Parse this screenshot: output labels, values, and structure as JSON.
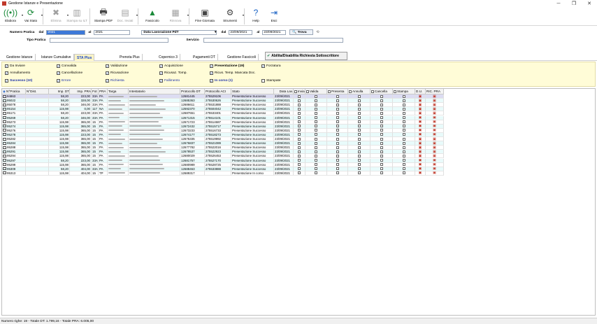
{
  "window": {
    "title": "Gestione Istanze e Presentazione",
    "minimize": "─",
    "maximize": "❐",
    "close": "✕"
  },
  "toolbar": [
    {
      "key": "elabora",
      "label": "Elabora",
      "icon": "((•))",
      "dis": false,
      "dd": true
    },
    {
      "key": "vai-stato",
      "label": "Vai Stato",
      "icon": "⟳",
      "dis": false,
      "dd": true
    },
    {
      "key": "elimina",
      "label": "Elimina",
      "icon": "✖",
      "dis": true,
      "dd": true
    },
    {
      "key": "stampa-ilt",
      "label": "Stampa su ILT",
      "icon": "▥",
      "dis": true,
      "dd": false
    },
    {
      "key": "stampa-pdf",
      "label": "Stampa PDF",
      "icon": "🖶",
      "dis": false,
      "dd": false
    },
    {
      "key": "doc-inviati",
      "label": "Doc. Inviati",
      "icon": "▤",
      "dis": true,
      "dd": true
    },
    {
      "key": "fascicolo",
      "label": "Fascicolo",
      "icon": "▲",
      "dis": false,
      "dd": false
    },
    {
      "key": "rinnova",
      "label": "Rinnova",
      "icon": "▦",
      "dis": true,
      "dd": true
    },
    {
      "key": "fine-giornata",
      "label": "Fine Giornata",
      "icon": "▣",
      "dis": false,
      "dd": false
    },
    {
      "key": "strumenti",
      "label": "Strumenti",
      "icon": "⚙",
      "dis": false,
      "dd": true
    },
    {
      "key": "help",
      "label": "Help",
      "icon": "?",
      "dis": false,
      "dd": false
    },
    {
      "key": "esci",
      "label": "Esci",
      "icon": "⇥",
      "dis": false,
      "dd": false
    }
  ],
  "filters": {
    "numero_pratica_label": "Numero Pratica",
    "dal_label": "dal",
    "al_label": "al",
    "num_dal": "2021",
    "num_al": "2021",
    "data_combo": "Data Lavorazione PdT",
    "data_dal_label": "dal",
    "data_dal": "23/09/2021",
    "data_al_label": "al",
    "data_al": "23/09/2021",
    "trova": "Trova",
    "tipo_pratica_label": "Tipo Pratica",
    "servizio_label": "Servizio"
  },
  "tabs": [
    "Gestione Istanze",
    "Istanze Cumulative",
    "STA Plus",
    "Prenota Plus",
    "Copernico 3",
    "Pagamenti DT",
    "Gestione Fascicoli"
  ],
  "abilita_label": "Abilita/Disabilita Richiesta Sottoscrittore",
  "status_checks": [
    {
      "label": "Da Inviare",
      "on": true,
      "bold": false,
      "blue": false
    },
    {
      "label": "Convalida",
      "on": true,
      "bold": false,
      "blue": false
    },
    {
      "label": "Validazione",
      "on": true,
      "bold": false,
      "blue": false
    },
    {
      "label": "Acquisizione",
      "on": true,
      "bold": false,
      "blue": false
    },
    {
      "label": "Presentazione (19)",
      "on": true,
      "bold": true,
      "blue": false
    },
    {
      "label": "Forzatura",
      "on": true,
      "bold": false,
      "blue": false
    },
    {
      "label": "Annullamento",
      "on": true,
      "bold": false,
      "blue": false
    },
    {
      "label": "Cancellazione",
      "on": true,
      "bold": false,
      "blue": false
    },
    {
      "label": "Ricusazione",
      "on": true,
      "bold": false,
      "blue": false
    },
    {
      "label": "Ricusaz. Tomp.",
      "on": true,
      "bold": false,
      "blue": false
    },
    {
      "label": "Ricus. Temp. Mancata Doc.",
      "on": true,
      "bold": false,
      "blue": false
    },
    {
      "label": "Successo (10)",
      "on": true,
      "bold": true,
      "blue": true
    },
    {
      "label": "Errore",
      "on": true,
      "bold": false,
      "blue": true
    },
    {
      "label": "Richiesta",
      "on": true,
      "bold": false,
      "blue": true
    },
    {
      "label": "Fallimento",
      "on": true,
      "bold": false,
      "blue": true
    },
    {
      "label": "In corso (1)",
      "on": true,
      "bold": true,
      "blue": true
    },
    {
      "label": "Stampate",
      "on": false,
      "bold": false,
      "blue": false
    }
  ],
  "columns": [
    "N°Pratica",
    "N°Dist.",
    "Imp. DT",
    "Imp. PRA",
    "Fot",
    "PRA",
    "Targa",
    "Intestatario",
    "Protocollo DT",
    "Protocollo ACI",
    "Stato",
    "Data Lav.",
    "Invia",
    "Valida",
    "Presenta",
    "Annulla",
    "Cancella",
    "Stampa",
    "D.U.",
    "RIC. PRA"
  ],
  "rows": [
    {
      "n": "94863",
      "dt": "58,20",
      "pra": "223,00",
      "fot": "33A",
      "prov": "PA",
      "pdt": "12681445",
      "paci": "275529106",
      "stato": "Presentazione Successo",
      "data": "23/09/2021"
    },
    {
      "n": "95022",
      "dt": "58,20",
      "pra": "328,00",
      "fot": "33A",
      "prov": "PA",
      "pdt": "12685363",
      "paci": "275530626",
      "stato": "Presentazione Successo",
      "data": "23/09/2021"
    },
    {
      "n": "95078",
      "dt": "58,20",
      "pra": "346,00",
      "fot": "33A",
      "prov": "PA",
      "pdt": "12686611",
      "paci": "275531888",
      "stato": "Presentazione Successo",
      "data": "23/09/2021"
    },
    {
      "n": "95154",
      "dt": "115,98",
      "pra": "0,00",
      "fot": "117",
      "prov": "NA",
      "pdt": "12592370",
      "paci": "275504042",
      "stato": "Presentazione Successo",
      "data": "23/09/2021"
    },
    {
      "n": "95171",
      "dt": "58,20",
      "pra": "223,00",
      "fot": "33A",
      "prov": "PA",
      "pdt": "12687651",
      "paci": "275533401",
      "stato": "Presentazione Successo",
      "data": "23/09/2021"
    },
    {
      "n": "95269",
      "dt": "58,20",
      "pra": "346,00",
      "fot": "33A",
      "prov": "PA",
      "pdt": "12671315",
      "paci": "275514101",
      "stato": "Presentazione Successo",
      "data": "23/09/2021"
    },
    {
      "n": "95273",
      "dt": "115,98",
      "pra": "365,00",
      "fot": "15",
      "prov": "PA",
      "pdt": "12671723",
      "paci": "275514687",
      "stato": "Presentazione Successo",
      "data": "23/09/2021"
    },
    {
      "n": "95274",
      "dt": "115,98",
      "pra": "365,00",
      "fot": "15",
      "prov": "PA",
      "pdt": "12672432",
      "paci": "275515717",
      "stato": "Presentazione Successo",
      "data": "23/09/2021"
    },
    {
      "n": "95276",
      "dt": "115,98",
      "pra": "365,00",
      "fot": "15",
      "prov": "PA",
      "pdt": "12673233",
      "paci": "275516733",
      "stato": "Presentazione Successo",
      "data": "23/09/2021"
    },
    {
      "n": "95278",
      "dt": "115,98",
      "pra": "223,00",
      "fot": "15",
      "prov": "PA",
      "pdt": "12674177",
      "paci": "275518273",
      "stato": "Presentazione Successo",
      "data": "23/09/2021"
    },
    {
      "n": "95282",
      "dt": "115,98",
      "pra": "365,00",
      "fot": "15",
      "prov": "PA",
      "pdt": "12675335",
      "paci": "275519992",
      "stato": "Presentazione Successo",
      "data": "23/09/2021"
    },
    {
      "n": "95284",
      "dt": "115,98",
      "pra": "365,00",
      "fot": "15",
      "prov": "PA",
      "pdt": "12676837",
      "paci": "275521089",
      "stato": "Presentazione Successo",
      "data": "23/09/2021"
    },
    {
      "n": "95288",
      "dt": "115,98",
      "pra": "365,00",
      "fot": "15",
      "prov": "PA",
      "pdt": "12677782",
      "paci": "275522016",
      "stato": "Presentazione Successo",
      "data": "23/09/2021"
    },
    {
      "n": "95291",
      "dt": "115,98",
      "pra": "365,00",
      "fot": "15",
      "prov": "PA",
      "pdt": "12678537",
      "paci": "275522923",
      "stato": "Presentazione Successo",
      "data": "23/09/2021"
    },
    {
      "n": "95294",
      "dt": "115,98",
      "pra": "365,00",
      "fot": "15",
      "prov": "PA",
      "pdt": "12680029",
      "paci": "275526453",
      "stato": "Presentazione Successo",
      "data": "23/09/2021"
    },
    {
      "n": "95297",
      "dt": "58,20",
      "pra": "223,00",
      "fot": "33A",
      "prov": "PA",
      "pdt": "12681757",
      "paci": "275527170",
      "stato": "Presentazione Successo",
      "data": "23/09/2021"
    },
    {
      "n": "95299",
      "dt": "115,98",
      "pra": "365,00",
      "fot": "15",
      "prov": "PA",
      "pdt": "12680989",
      "paci": "275528725",
      "stato": "Presentazione Successo",
      "data": "23/09/2021"
    },
    {
      "n": "95309",
      "dt": "58,20",
      "pra": "404,00",
      "fot": "33A",
      "prov": "PA",
      "pdt": "12688463",
      "paci": "275533888",
      "stato": "Presentazione Successo",
      "data": "23/09/2021"
    },
    {
      "n": "95313",
      "dt": "115,98",
      "pra": "404,00",
      "fot": "15",
      "prov": "TP",
      "pdt": "12689317",
      "paci": "",
      "stato": "Presentazione In corso",
      "data": "23/09/2021"
    }
  ],
  "status": "Numero righe: 19 - Totale DT: 1.799,16 - Totale PRA: 6.005,00"
}
